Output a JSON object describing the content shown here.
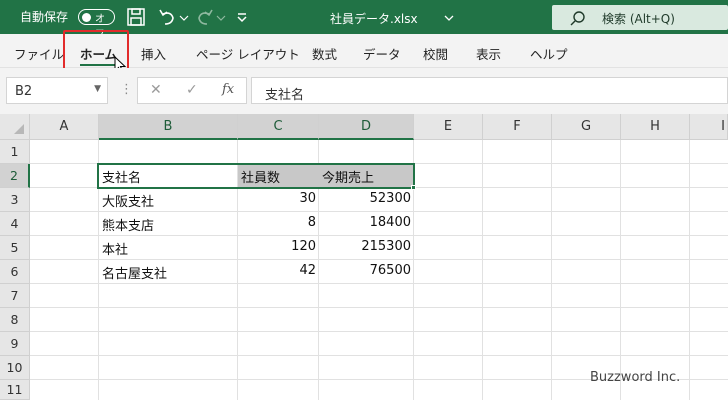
{
  "titlebar": {
    "autosave_label": "自動保存",
    "autosave_state": "オフ",
    "filename": "社員データ.xlsx",
    "search_placeholder": "検索 (Alt+Q)",
    "bg_color": "#217346"
  },
  "ribbon": {
    "tabs": [
      {
        "label": "ファイル"
      },
      {
        "label": "ホーム",
        "active": true
      },
      {
        "label": "挿入"
      },
      {
        "label": "ページ レイアウト"
      },
      {
        "label": "数式"
      },
      {
        "label": "データ"
      },
      {
        "label": "校閲"
      },
      {
        "label": "表示"
      },
      {
        "label": "ヘルプ"
      }
    ]
  },
  "formula_bar": {
    "name_box": "B2",
    "fx_label": "fx",
    "content": "支社名"
  },
  "sheet": {
    "columns": [
      "A",
      "B",
      "C",
      "D",
      "E",
      "F",
      "G",
      "H",
      "I"
    ],
    "rows": [
      "1",
      "2",
      "3",
      "4",
      "5",
      "6",
      "7",
      "8",
      "9",
      "10",
      "11"
    ],
    "table": {
      "headers": [
        "支社名",
        "社員数",
        "今期売上"
      ],
      "rows": [
        [
          "大阪支社",
          "30",
          "52300"
        ],
        [
          "熊本支店",
          "8",
          "18400"
        ],
        [
          "本社",
          "120",
          "215300"
        ],
        [
          "名古屋支社",
          "42",
          "76500"
        ]
      ]
    }
  },
  "watermark": "Buzzword Inc."
}
